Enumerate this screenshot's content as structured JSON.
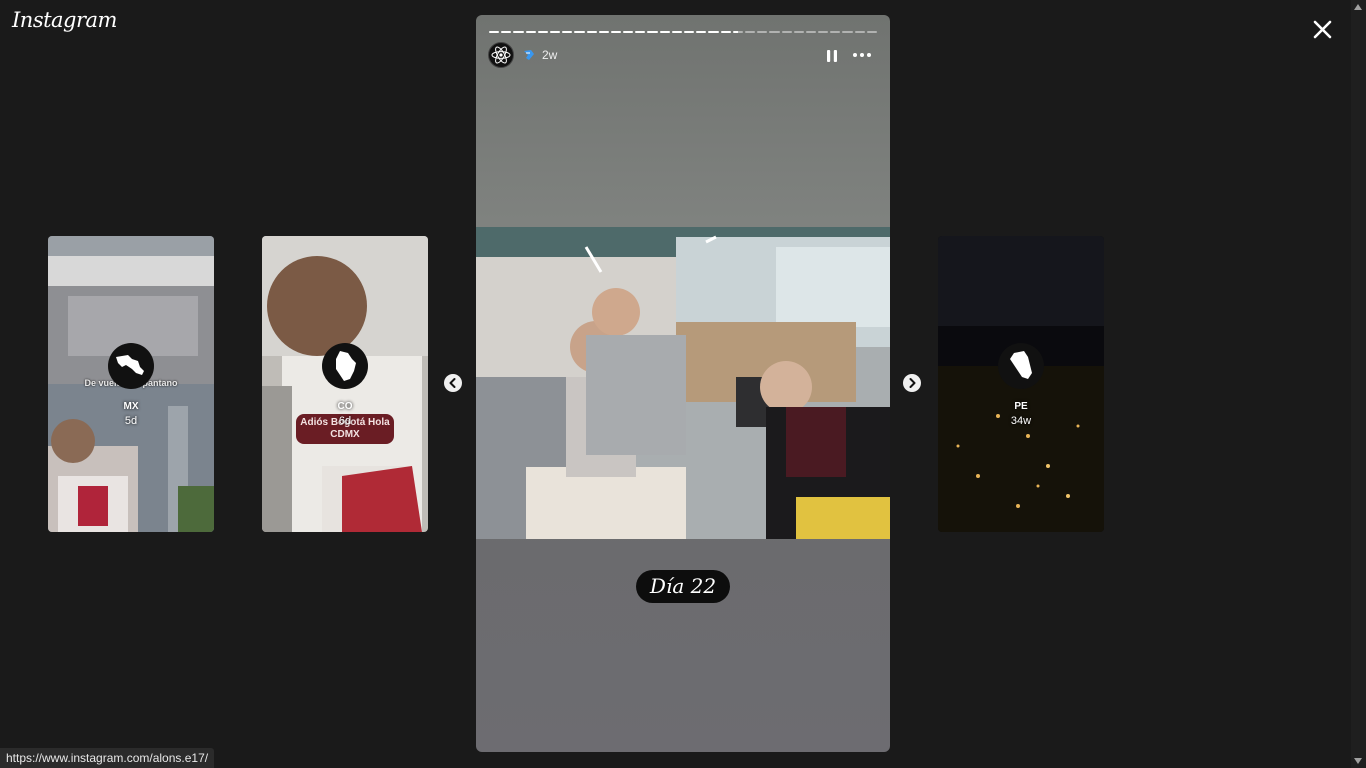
{
  "app": {
    "logo": "Instagram"
  },
  "status_url": "https://www.instagram.com/alons.e17/",
  "previews": [
    {
      "name": "MX",
      "time": "5d",
      "overlay_text": "De vuelto a... pantano"
    },
    {
      "name": "CO",
      "time": "6d",
      "sticker_text": "Adiós Bogotá Hola CDMX"
    },
    {
      "name": "PE",
      "time": "34w"
    }
  ],
  "story": {
    "time": "2w",
    "day_label": "Día 22",
    "progress": {
      "segments": 32,
      "current": 20
    }
  },
  "icons": {
    "close": "close-icon",
    "pause": "pause-icon",
    "more": "more-options-icon",
    "prev": "chevron-left-icon",
    "next": "chevron-right-icon",
    "verified": "verified-badge-icon"
  },
  "colors": {
    "background": "#1a1a1a",
    "accent_blue": "#3897f0"
  }
}
